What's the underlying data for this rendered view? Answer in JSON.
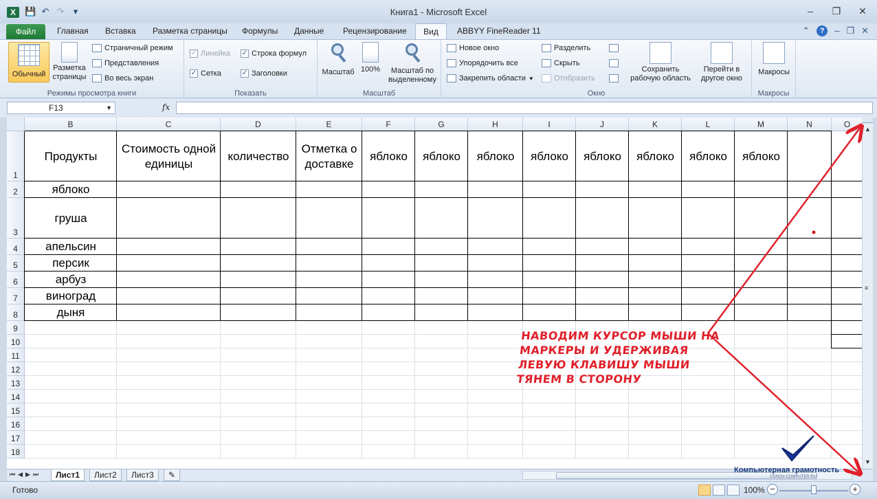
{
  "titlebar": {
    "title": "Книга1  -  Microsoft Excel",
    "app_icon": "X",
    "qat_icons": [
      "save-icon",
      "undo-icon",
      "redo-icon",
      "customize-icon"
    ]
  },
  "tabs": {
    "file": "Файл",
    "items": [
      "Главная",
      "Вставка",
      "Разметка страницы",
      "Формулы",
      "Данные",
      "Рецензирование",
      "Вид",
      "ABBYY FineReader 11"
    ],
    "active": "Вид"
  },
  "ribbon": {
    "views": {
      "normal": "Обычный",
      "page_layout": "Разметка страницы",
      "page_break": "Страничный режим",
      "custom_views": "Представления",
      "full_screen": "Во весь экран",
      "label": "Режимы просмотра книги"
    },
    "show": {
      "ruler": "Линейка",
      "formula_bar": "Строка формул",
      "gridlines": "Сетка",
      "headings": "Заголовки",
      "label": "Показать"
    },
    "zoom": {
      "zoom": "Масштаб",
      "hundred": "100%",
      "to_selection": "Масштаб по выделенному",
      "label": "Масштаб"
    },
    "window": {
      "new_window": "Новое окно",
      "arrange_all": "Упорядочить все",
      "freeze": "Закрепить области",
      "split": "Разделить",
      "hide": "Скрыть",
      "unhide": "Отобразить",
      "save_workspace": "Сохранить рабочую область",
      "switch": "Перейти в другое окно",
      "label": "Окно"
    },
    "macros": {
      "macros": "Макросы",
      "label": "Макросы"
    }
  },
  "formula_bar": {
    "name_box": "F13",
    "fx": "fx",
    "formula": ""
  },
  "grid": {
    "columns": [
      "B",
      "C",
      "D",
      "E",
      "F",
      "G",
      "H",
      "I",
      "J",
      "K",
      "L",
      "M",
      "N",
      "O"
    ],
    "rows": [
      "1",
      "2",
      "3",
      "4",
      "5",
      "6",
      "7",
      "8",
      "9",
      "10",
      "11",
      "12",
      "13",
      "14",
      "15",
      "16",
      "17",
      "18"
    ],
    "header_row": [
      "Продукты",
      "Стоимость одной единицы",
      "количество",
      "Отметка о доставке",
      "яблоко",
      "яблоко",
      "яблоко",
      "яблоко",
      "яблоко",
      "яблоко",
      "яблоко",
      "яблоко"
    ],
    "products": [
      "яблоко",
      "груша",
      "апельсин",
      "персик",
      "арбуз",
      "виноград",
      "дыня"
    ]
  },
  "sheets": [
    "Лист1",
    "Лист2",
    "Лист3"
  ],
  "status": {
    "ready": "Готово",
    "zoom": "100%"
  },
  "annotation": {
    "text": "Наводим курсор мыши на маркеры и удерживая левую клавишу мыши тянем в сторону",
    "color": "#e0202a"
  },
  "watermark": {
    "title": "Компьютерная грамотность",
    "url": "OSNOV-COMPUTER.RU"
  }
}
